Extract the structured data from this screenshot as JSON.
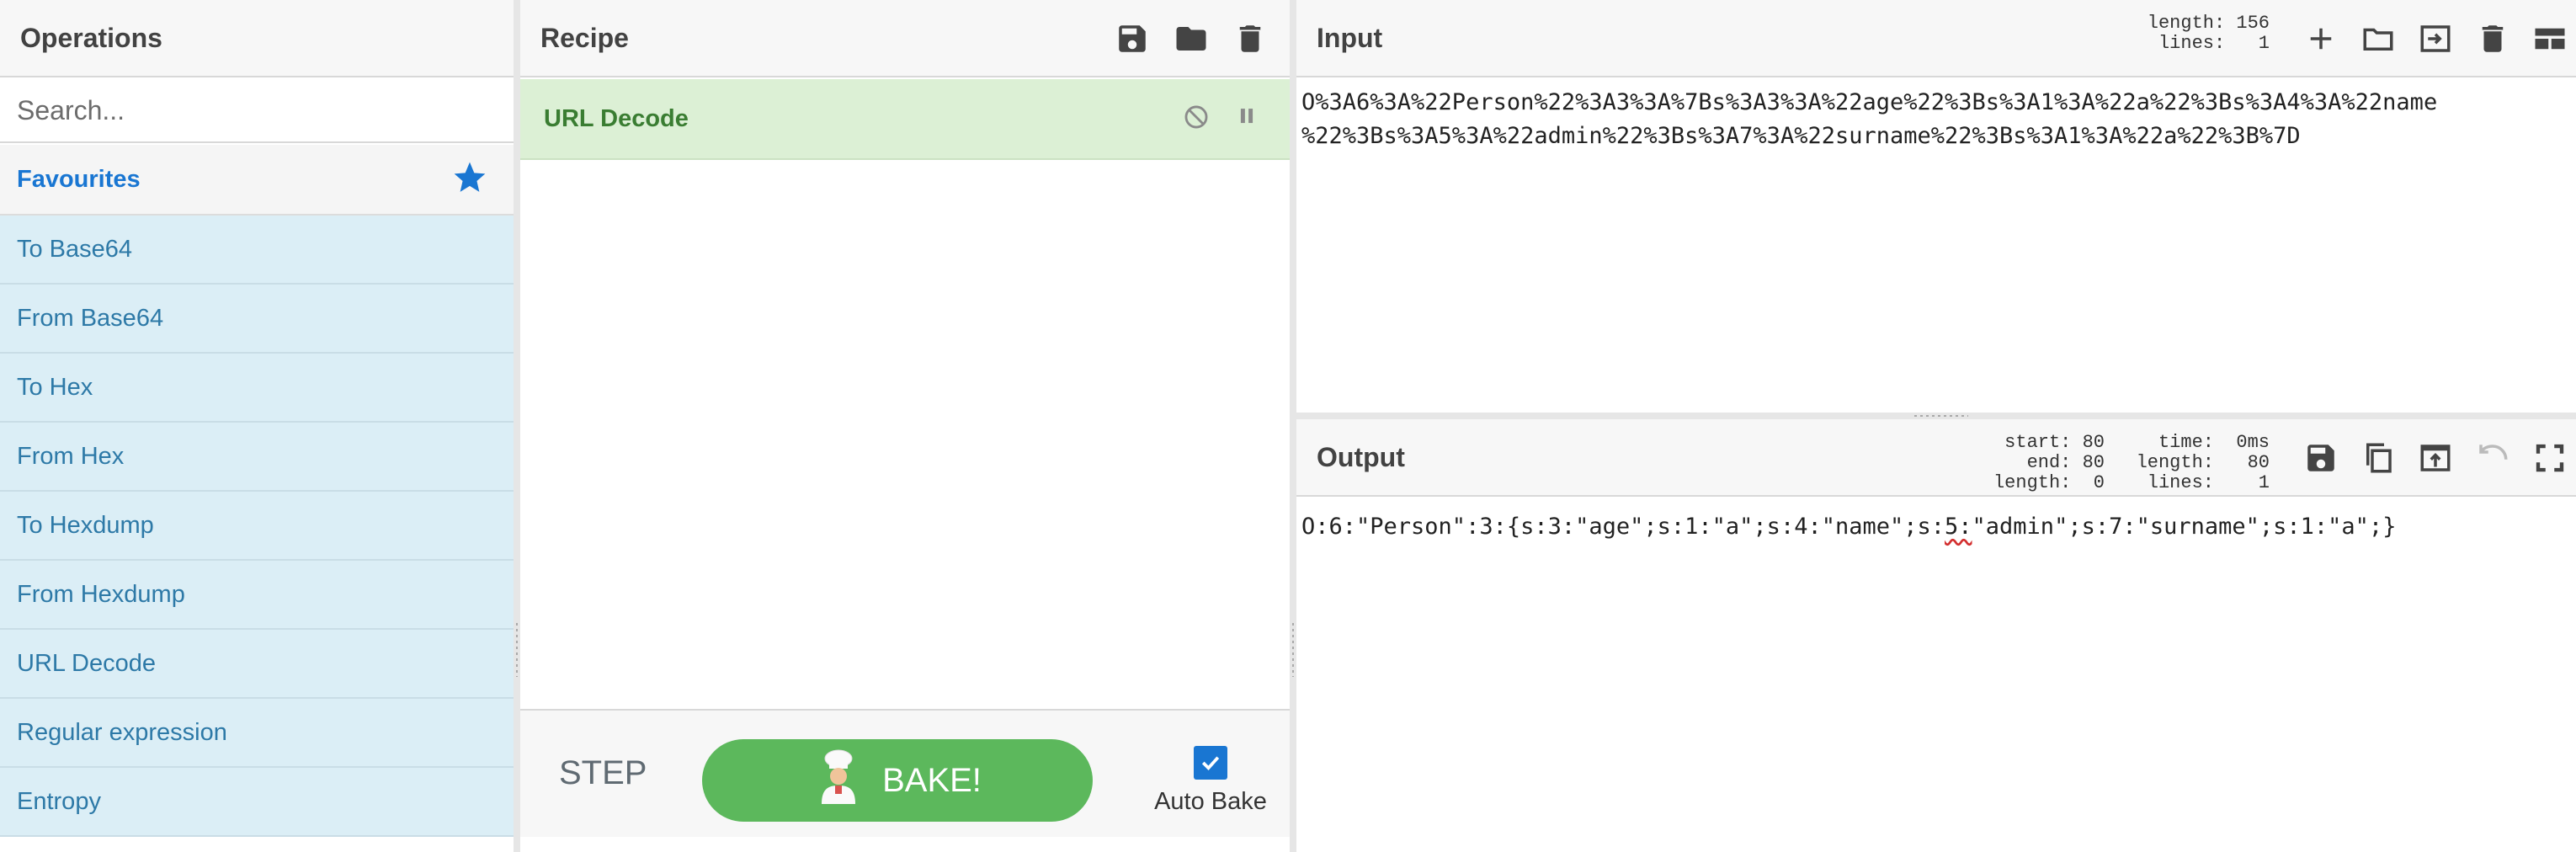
{
  "operations": {
    "title": "Operations",
    "search_placeholder": "Search...",
    "favourites_label": "Favourites",
    "items": [
      {
        "label": "To Base64"
      },
      {
        "label": "From Base64"
      },
      {
        "label": "To Hex"
      },
      {
        "label": "From Hex"
      },
      {
        "label": "To Hexdump"
      },
      {
        "label": "From Hexdump"
      },
      {
        "label": "URL Decode"
      },
      {
        "label": "Regular expression"
      },
      {
        "label": "Entropy"
      }
    ]
  },
  "recipe": {
    "title": "Recipe",
    "ops": [
      {
        "label": "URL Decode"
      }
    ],
    "step_label": "STEP",
    "bake_label": "BAKE!",
    "autobake_label": "Auto Bake",
    "autobake_checked": true
  },
  "input": {
    "title": "Input",
    "length_label": "length:",
    "length_value": "156",
    "lines_label": "lines:",
    "lines_value": "1",
    "line1": "O%3A6%3A%22Person%22%3A3%3A%7Bs%3A3%3A%22age%22%3Bs%3A1%3A%22a%22%3Bs%3A4%3A%22name",
    "line2": "%22%3Bs%3A5%3A%22admin%22%3Bs%3A7%3A%22surname%22%3Bs%3A1%3A%22a%22%3B%7D"
  },
  "output": {
    "title": "Output",
    "start_label": "start:",
    "start_value": "80",
    "end_label": "end:",
    "end_value": "80",
    "sel_length_label": "length:",
    "sel_length_value": "0",
    "time_label": "time:",
    "time_value": "0ms",
    "length_label": "length:",
    "length_value": "80",
    "lines_label": "lines:",
    "lines_value": "1",
    "text_before": "O:6:\"Person\":3:{s:3:\"age\";s:1:\"a\";s:4:\"name\";s:",
    "text_error": "5:",
    "text_after": "\"admin\";s:7:\"surname\";s:1:\"a\";}"
  },
  "colors": {
    "accent": "#1976d2",
    "bake_green": "#5cb85c",
    "recipe_op_bg": "#dcf0d5",
    "op_item_bg": "#dbeef6"
  }
}
